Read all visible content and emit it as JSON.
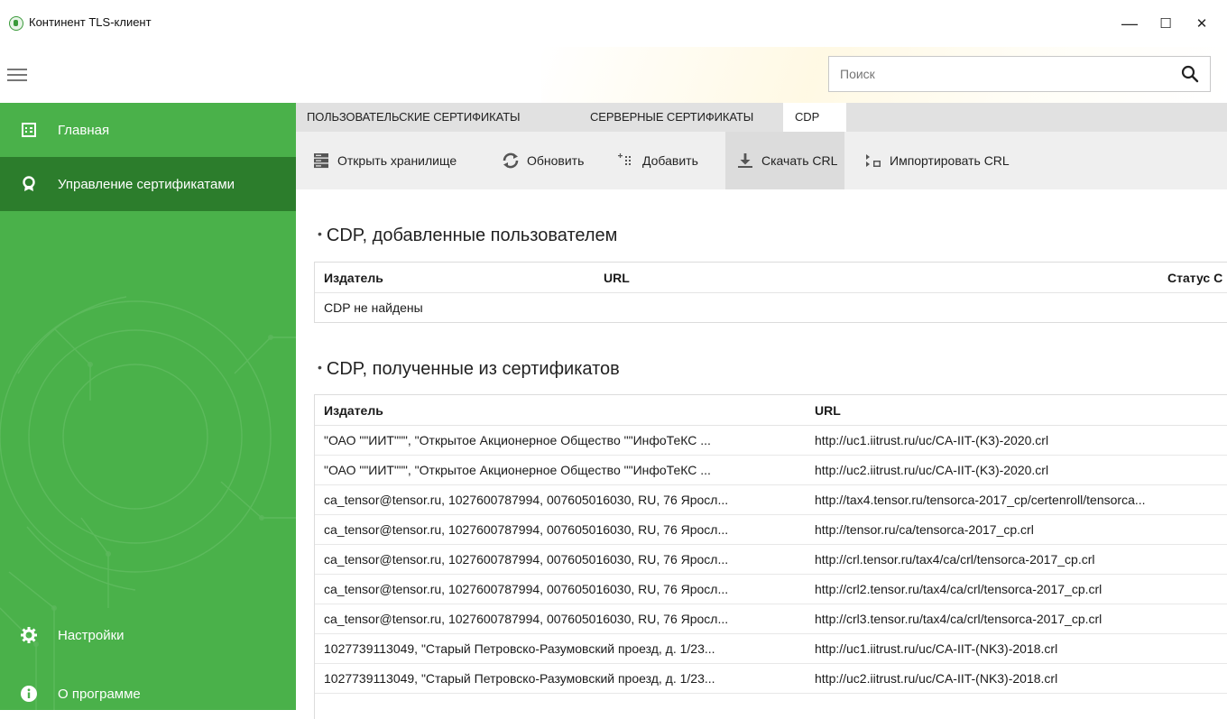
{
  "window": {
    "title": "Континент TLS-клиент",
    "minimize": "—",
    "maximize": "☐",
    "close": "✕"
  },
  "search": {
    "placeholder": "Поиск"
  },
  "sidebar": {
    "items": [
      {
        "label": "Главная",
        "icon": "home-grid-icon"
      },
      {
        "label": "Управление сертификатами",
        "icon": "certificate-icon"
      },
      {
        "label": "Настройки",
        "icon": "gear-icon"
      },
      {
        "label": "О программе",
        "icon": "info-icon"
      }
    ],
    "active_index": 1,
    "colors": {
      "base": "#4ab14a",
      "active": "#2c7d2c"
    }
  },
  "tabs": [
    {
      "label": "ПОЛЬЗОВАТЕЛЬСКИЕ СЕРТИФИКАТЫ"
    },
    {
      "label": "СЕРВЕРНЫЕ СЕРТИФИКАТЫ"
    },
    {
      "label": "CDP"
    }
  ],
  "active_tab": "CDP",
  "toolbar": {
    "open_store": "Открыть хранилище",
    "refresh": "Обновить",
    "add": "Добавить",
    "download_crl": "Скачать CRL",
    "import_crl": "Импортировать CRL"
  },
  "user_cdp": {
    "bullet": "•",
    "title": "CDP, добавленные пользователем",
    "columns": {
      "issuer": "Издатель",
      "url": "URL",
      "status": "Статус С"
    },
    "empty": "CDP не найдены"
  },
  "cert_cdp": {
    "bullet": "•",
    "title": "CDP, полученные из сертификатов",
    "columns": {
      "issuer": "Издатель",
      "url": "URL"
    },
    "rows": [
      {
        "issuer": "\"ОАО \"\"ИИТ\"\"\", \"Открытое Акционерное Общество \"\"ИнфоТеКС ...",
        "url": "http://uc1.iitrust.ru/uc/CA-IIT-(K3)-2020.crl"
      },
      {
        "issuer": "\"ОАО \"\"ИИТ\"\"\", \"Открытое Акционерное Общество \"\"ИнфоТеКС ...",
        "url": "http://uc2.iitrust.ru/uc/CA-IIT-(K3)-2020.crl"
      },
      {
        "issuer": "ca_tensor@tensor.ru, 1027600787994, 007605016030, RU, 76 Яросл...",
        "url": "http://tax4.tensor.ru/tensorca-2017_cp/certenroll/tensorca..."
      },
      {
        "issuer": "ca_tensor@tensor.ru, 1027600787994, 007605016030, RU, 76 Яросл...",
        "url": "http://tensor.ru/ca/tensorca-2017_cp.crl"
      },
      {
        "issuer": "ca_tensor@tensor.ru, 1027600787994, 007605016030, RU, 76 Яросл...",
        "url": "http://crl.tensor.ru/tax4/ca/crl/tensorca-2017_cp.crl"
      },
      {
        "issuer": "ca_tensor@tensor.ru, 1027600787994, 007605016030, RU, 76 Яросл...",
        "url": "http://crl2.tensor.ru/tax4/ca/crl/tensorca-2017_cp.crl"
      },
      {
        "issuer": "ca_tensor@tensor.ru, 1027600787994, 007605016030, RU, 76 Яросл...",
        "url": "http://crl3.tensor.ru/tax4/ca/crl/tensorca-2017_cp.crl"
      },
      {
        "issuer": "1027739113049, \"Старый Петровско-Разумовский проезд, д. 1/23...",
        "url": "http://uc1.iitrust.ru/uc/CA-IIT-(NK3)-2018.crl"
      },
      {
        "issuer": "1027739113049, \"Старый Петровско-Разумовский проезд, д. 1/23...",
        "url": "http://uc2.iitrust.ru/uc/CA-IIT-(NK3)-2018.crl"
      }
    ]
  }
}
